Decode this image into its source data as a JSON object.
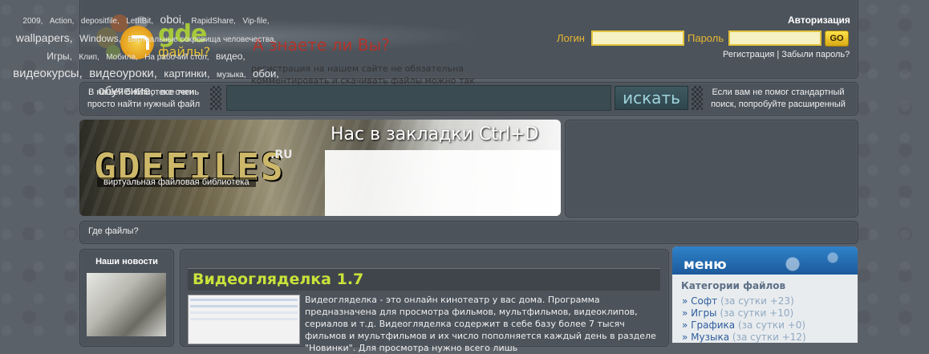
{
  "header": {
    "logo_word": "gde",
    "logo_sub": "файлы?",
    "auth_title": "Авторизация",
    "login_label": "Логин",
    "password_label": "Пароль",
    "go_label": "GO",
    "register_link": "Регистрация",
    "separator": "|",
    "forgot_link": "Забыли пароль?"
  },
  "search": {
    "left_note_1": "В нашей библиотеке очень",
    "left_note_2": "просто найти нужный файл",
    "button_label": "искать",
    "right_note_1": "Если вам не помог стандартный",
    "right_note_2": "поиск, попробуйте расширенный"
  },
  "banner": {
    "logo": "GDEFILES",
    "logo_sup": ".RU",
    "tagline": "виртуальная файловая библиотека",
    "bookmark": "Нас в закладки Ctrl+D",
    "didyou_title": "А знаете ли Вы?",
    "didyou_text": "регистрация на нашем сайте не обязательна комментировать и скачивать файлы можно так"
  },
  "tags": [
    {
      "t": "2009,",
      "s": 10
    },
    {
      "t": "Action,",
      "s": 10
    },
    {
      "t": "depositfile,",
      "s": 10
    },
    {
      "t": "LetItBit,",
      "s": 10
    },
    {
      "t": "oboi,",
      "s": 14
    },
    {
      "t": "RapidShare,",
      "s": 10
    },
    {
      "t": "Vip-file,",
      "s": 10
    },
    {
      "t": "wallpapers,",
      "s": 14
    },
    {
      "t": "Windows,",
      "s": 12
    },
    {
      "t": "Виртуальные сокровища человечества,",
      "s": 10
    },
    {
      "t": "Игры,",
      "s": 12
    },
    {
      "t": "Клип,",
      "s": 10
    },
    {
      "t": "Мобила,",
      "s": 10
    },
    {
      "t": "На рабочий стол,",
      "s": 10
    },
    {
      "t": "видео,",
      "s": 12
    },
    {
      "t": "видеокурсы,",
      "s": 15
    },
    {
      "t": "видеоуроки,",
      "s": 15
    },
    {
      "t": "картинки,",
      "s": 13
    },
    {
      "t": "музыка,",
      "s": 10
    },
    {
      "t": "обои,",
      "s": 13
    },
    {
      "t": "обучение,",
      "s": 15
    },
    {
      "t": "все теги",
      "s": 11
    }
  ],
  "breadcrumb": "Где файлы?",
  "news": {
    "title": "Наши новости"
  },
  "article": {
    "title": "Видеогляделка 1.7",
    "text": "Видеогляделка - это онлайн кинотеатр у вас дома. Программа предназначена для просмотра фильмов, мультфильмов, видеоклипов, сериалов и т.д. Видеогляделка содержит в себе базу более 7 тысяч фильмов и мультфильмов и их число пополняется каждый день в разделе \"Новинки\". Для просмотра нужно всего лишь"
  },
  "menu": {
    "title": "меню",
    "categories_title": "Категории файлов",
    "items": [
      {
        "name": "Софт",
        "count": "(за сутки +23)"
      },
      {
        "name": "Игры",
        "count": "(за сутки +10)"
      },
      {
        "name": "Графика",
        "count": "(за сутки +0)"
      },
      {
        "name": "Музыка",
        "count": "(за сутки +12)"
      }
    ]
  },
  "colors": {
    "accent_green": "#a6c93a",
    "accent_yellow": "#e8b730",
    "link_blue": "#2d5d9e"
  }
}
